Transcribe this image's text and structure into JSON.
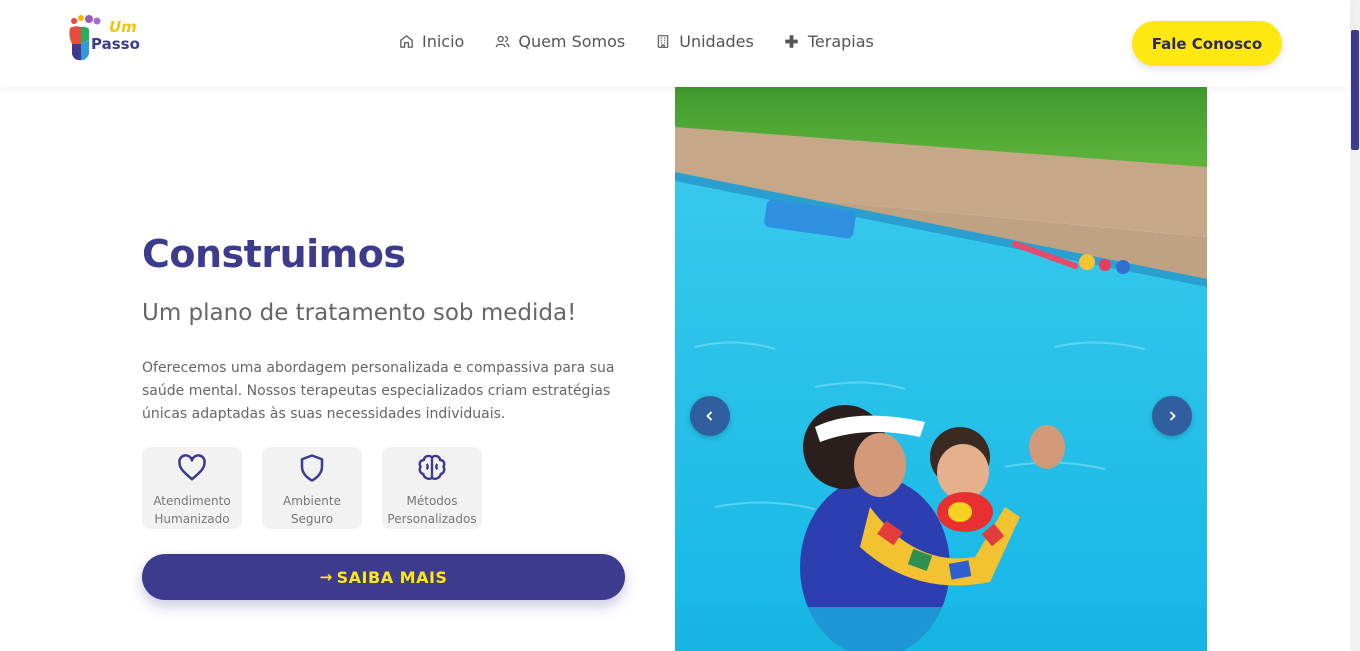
{
  "header": {
    "logo": {
      "line1": "Um",
      "line2": "Passo"
    },
    "nav": [
      {
        "label": "Inicio",
        "icon": "home-icon"
      },
      {
        "label": "Quem Somos",
        "icon": "users-icon"
      },
      {
        "label": "Unidades",
        "icon": "building-icon"
      },
      {
        "label": "Terapias",
        "icon": "plus-icon"
      }
    ],
    "cta_label": "Fale Conosco"
  },
  "hero": {
    "title": "Construimos",
    "subtitle": "Um plano de tratamento sob medida!",
    "description": "Oferecemos uma abordagem personalizada e compassiva para sua saúde mental. Nossos terapeutas especializados criam estratégias únicas adaptadas às suas necessidades individuais.",
    "features": [
      {
        "line1": "Atendimento",
        "line2": "Humanizado",
        "icon": "heart-icon"
      },
      {
        "line1": "Ambiente",
        "line2": "Seguro",
        "icon": "shield-icon"
      },
      {
        "line1": "Métodos",
        "line2": "Personalizados",
        "icon": "brain-icon"
      }
    ],
    "button_label": "SAIBA MAIS",
    "button_icon": "arrow-right-icon"
  },
  "carousel": {
    "image": "pool-therapy-photo",
    "prev_icon": "chevron-left-icon",
    "next_icon": "chevron-right-icon"
  },
  "colors": {
    "primary": "#3d3b8e",
    "accent": "#ffe812",
    "carousel_button": "#2f5f9e"
  }
}
